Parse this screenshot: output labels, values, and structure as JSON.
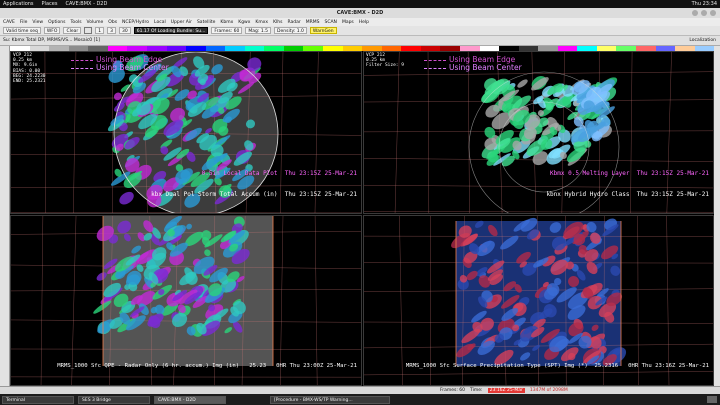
{
  "system_bar": {
    "applications": "Applications",
    "places": "Places",
    "app_name": "CAVE:BMX - D2D",
    "clock": "Thu 23:34"
  },
  "window": {
    "title": "CAVE:BMX - D2D"
  },
  "menus": [
    "CAVE",
    "File",
    "View",
    "Options",
    "Tools",
    "Volume",
    "Obs",
    "NCEP/Hydro",
    "Local",
    "Upper Air",
    "Satellite",
    "Kbmx",
    "Kgwx",
    "Kmxx",
    "Klhs",
    "Radar",
    "MRMS",
    "SCAN",
    "Maps",
    "Help"
  ],
  "toolbar": {
    "loading": "61.17 Of Loading Bundle: Su...",
    "frames_label": "Frames: 60",
    "mag_label": "Mag: 1.5",
    "density_label": "Density: 1.0",
    "warngen": "WarnGen",
    "valid_time": "Valid time seq",
    "wfo": "WFO",
    "clear": "Clear",
    "numbers": [
      "1",
      "3",
      "30"
    ]
  },
  "tabs": {
    "main": "Su: Kbmx Total DP, MRMS/VS... Mosaic0 [1]"
  },
  "localization": "Localization",
  "colorbar": [
    "#ffffff",
    "#d9d9d9",
    "#b3b3b3",
    "#8c8c8c",
    "#666666",
    "#ff00ff",
    "#cc00ff",
    "#9900ff",
    "#6600ff",
    "#0000ff",
    "#0066ff",
    "#00ccff",
    "#00ffcc",
    "#00ff66",
    "#00cc00",
    "#66ff00",
    "#ffff00",
    "#ffcc00",
    "#ff9900",
    "#ff6600",
    "#ff0000",
    "#cc0000",
    "#990000",
    "#ff99cc",
    "#ffffff",
    "#000000",
    "#333333",
    "#999999",
    "#ff00ff",
    "#00ffff",
    "#ffff66",
    "#66ff66",
    "#ff6666",
    "#6666ff",
    "#ffcc99",
    "#99ccff"
  ],
  "panes": [
    {
      "info": "VCP 212\n0.25 km\nMX: 9.6in\nBIAS: 0.00\nBEG: 24.2230\nEND: 25.2321",
      "legend": [
        "Using Beam Edge",
        "Using Beam Center"
      ],
      "captions": [
        "0.5in Local Data Plot  Thu 23:15Z 25-Mar-21",
        "kbx Dual Pol Storm Total Accum (in)  Thu 23:15Z 25-Mar-21"
      ]
    },
    {
      "info": "VCP 212\n0.25 km\nFilter Size: 9",
      "legend": [
        "Using Beam Edge",
        "Using Beam Center"
      ],
      "captions": [
        "Kbmx 0.5 Melting Layer  Thu 23:15Z 25-Mar-21",
        "kbnx Hybrid Hydro Class  Thu 23:15Z 25-Mar-21"
      ]
    },
    {
      "info": "",
      "legend": [],
      "captions": [
        "MRMS_1000 Sfc QPE - Radar Only (6 hr. accum.) Img (in)   25.23   0HR Thu 23:00Z 25-Mar-21"
      ]
    },
    {
      "info": "",
      "legend": [],
      "captions": [
        "MRMS_1000 Sfc Surface Precipitation Type (SPT) Img (*)  25.2316   0HR Thu 23:16Z 25-Mar-21"
      ]
    }
  ],
  "status": {
    "frames": "Frames: 60",
    "time_label": "Time:",
    "time_value": "23:16Z 25-Mar",
    "memory": "1347M of 2098M"
  },
  "taskbar": [
    {
      "label": "Terminal"
    },
    {
      "label": "SES 3 Bridge"
    },
    {
      "label": "CAVE:BMX - D2D"
    },
    {
      "label": "[Procedure - BMX-WS/TP Warning..."
    }
  ],
  "colors": {
    "legend_edge": "#d050d0",
    "legend_center": "#e080ff",
    "caption": "#ffffff",
    "caption_magenta": "#ff66ff"
  }
}
